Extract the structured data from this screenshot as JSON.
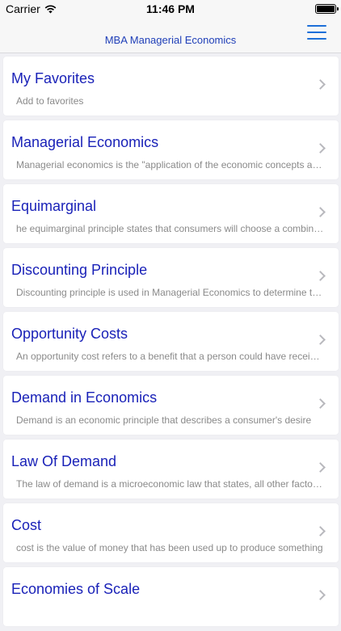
{
  "status": {
    "carrier": "Carrier",
    "time": "11:46 PM"
  },
  "nav": {
    "title": "MBA Managerial Economics",
    "menu_icon": "hamburger-icon"
  },
  "items": [
    {
      "title": "My Favorites",
      "subtitle": "Add to favorites"
    },
    {
      "title": "Managerial Economics",
      "subtitle": "Managerial economics is the \"application of the economic concepts and economic analysis to the problems"
    },
    {
      "title": "Equimarginal",
      "subtitle": "he equimarginal principle states that consumers will choose a combination of goods"
    },
    {
      "title": "Discounting Principle",
      "subtitle": "Discounting principle is used in Managerial Economics to determine the present value"
    },
    {
      "title": "Opportunity Costs",
      "subtitle": "An opportunity cost refers to a benefit that a person could have received"
    },
    {
      "title": "Demand in Economics",
      "subtitle": "Demand is an economic principle that describes a consumer's desire"
    },
    {
      "title": "Law Of Demand",
      "subtitle": "The law of demand is a microeconomic law that states, all other factors being equal"
    },
    {
      "title": "Cost",
      "subtitle": "cost is the value of money that has been used up to produce something"
    },
    {
      "title": "Economies of Scale",
      "subtitle": ""
    }
  ]
}
